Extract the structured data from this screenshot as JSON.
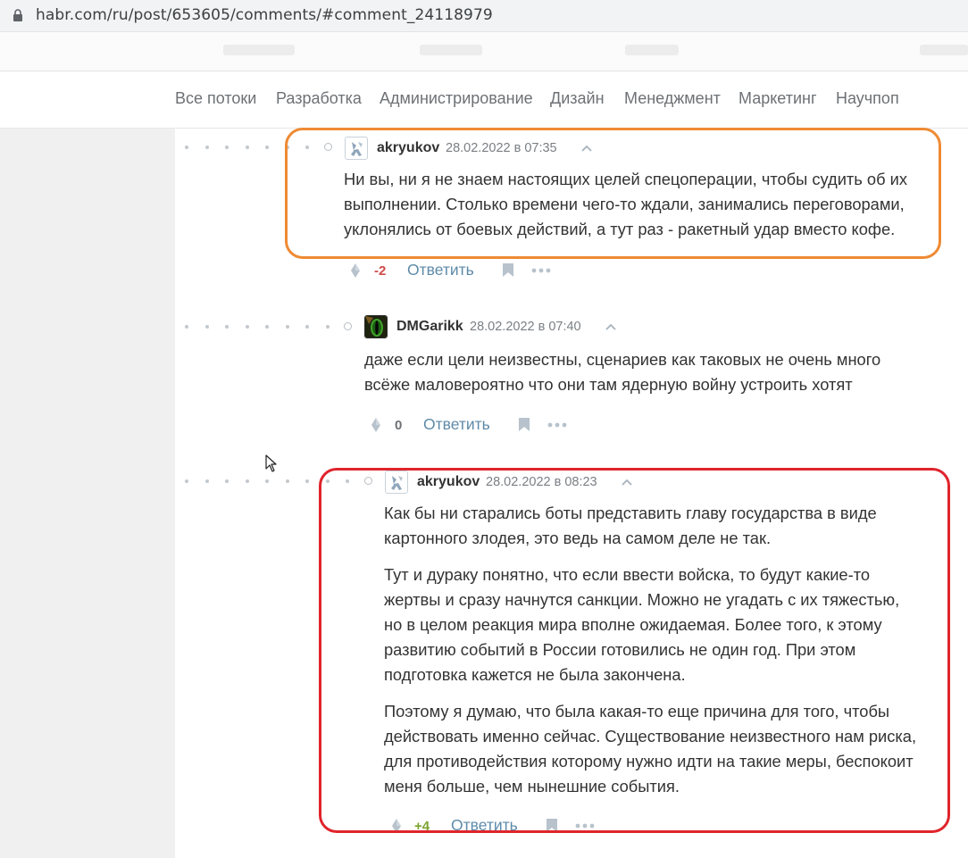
{
  "browser": {
    "url": "habr.com/ru/post/653605/comments/#comment_24118979"
  },
  "nav": {
    "items": [
      "Все потоки",
      "Разработка",
      "Администрирование",
      "Дизайн",
      "Менеджмент",
      "Маркетинг",
      "Научпоп"
    ]
  },
  "comments": [
    {
      "author": "akryukov",
      "date": "28.02.2022 в 07:35",
      "avatar_icon": "identicon-avatar",
      "paragraphs": [
        [
          "Ни вы, ни я не знаем настоящих целей спецоперации, чтобы судить об их",
          "выполнении. Столько времени чего-то ждали, занимались переговорами,",
          "уклонялись от боевых действий, а тут раз - ракетный удар вместо кофе."
        ]
      ],
      "score": "-2",
      "score_color": "#d04a4a",
      "reply_label": "Ответить",
      "highlight_color": "#ef8a33"
    },
    {
      "author": "DMGarikk",
      "date": "28.02.2022 в 07:40",
      "avatar_icon": "dragon-eye-avatar",
      "paragraphs": [
        [
          "даже если цели неизвестны, сценариев как таковых не очень много",
          "всёже маловероятно что они там ядерную войну устроить хотят"
        ]
      ],
      "score": "0",
      "score_color": "#6d7175",
      "reply_label": "Ответить"
    },
    {
      "author": "akryukov",
      "date": "28.02.2022 в 08:23",
      "avatar_icon": "identicon-avatar",
      "paragraphs": [
        [
          "Как бы ни старались боты представить главу государства в виде",
          "картонного злодея, это ведь на самом деле не так."
        ],
        [
          "Тут и дураку понятно, что если ввести войска, то будут какие-то",
          "жертвы и сразу начнутся санкции. Можно не угадать с их тяжестью,",
          "но в целом реакция мира вполне ожидаемая. Более того, к этому",
          "развитию событий в России готовились не один год. При этом",
          "подготовка кажется не была закончена."
        ],
        [
          "Поэтому я думаю, что была какая-то еще причина для того, чтобы",
          "действовать именно сейчас. Существование неизвестного нам риска,",
          "для противодействия которому нужно идти на такие меры, беспокоит",
          "меня больше, чем нынешние события."
        ]
      ],
      "score": "+4",
      "score_color": "#7ba32e",
      "reply_label": "Ответить",
      "highlight_color": "#e0242b"
    }
  ],
  "colors": {
    "accent_link": "#5e8aa8",
    "thread_dots": "#c3c8cc"
  }
}
